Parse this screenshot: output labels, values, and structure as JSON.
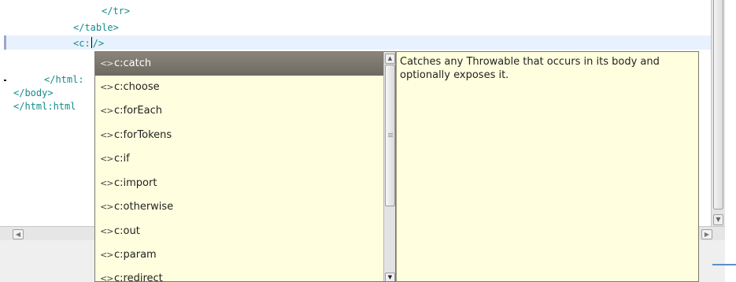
{
  "editor": {
    "lines": [
      "</tr>",
      "</table>",
      "<c:",
      "/>",
      "</html:",
      "</body>",
      "</html:html"
    ]
  },
  "content_assist": {
    "items": [
      {
        "label": "c:catch",
        "icon": "tag-icon",
        "selected": true
      },
      {
        "label": "c:choose",
        "icon": "tag-icon",
        "selected": false
      },
      {
        "label": "c:forEach",
        "icon": "tag-icon",
        "selected": false
      },
      {
        "label": "c:forTokens",
        "icon": "tag-icon",
        "selected": false
      },
      {
        "label": "c:if",
        "icon": "tag-icon",
        "selected": false
      },
      {
        "label": "c:import",
        "icon": "tag-icon",
        "selected": false
      },
      {
        "label": "c:otherwise",
        "icon": "tag-icon",
        "selected": false
      },
      {
        "label": "c:out",
        "icon": "tag-icon",
        "selected": false
      },
      {
        "label": "c:param",
        "icon": "tag-icon",
        "selected": false
      },
      {
        "label": "c:redirect",
        "icon": "tag-icon",
        "selected": false
      }
    ],
    "icon_glyph": "<>",
    "selected_color": "#6f6a60",
    "background_color": "#ffffdf"
  },
  "documentation": {
    "text": "Catches any Throwable that occurs in its body and optionally exposes it."
  },
  "colors": {
    "code_text": "#178a8c",
    "current_line": "#e8f2fe"
  }
}
